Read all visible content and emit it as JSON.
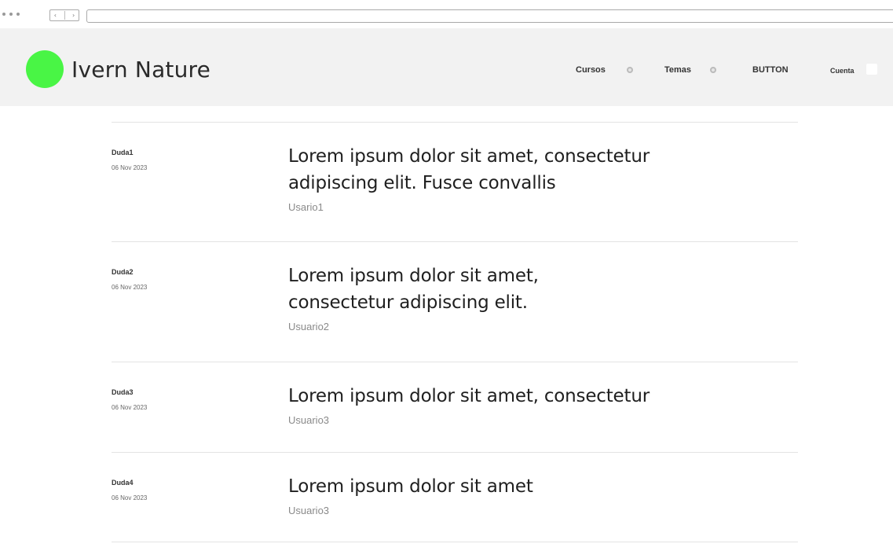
{
  "header": {
    "brand_name": "Ivern Nature",
    "logo_color": "#49f545",
    "nav": {
      "cursos": "Cursos",
      "temas": "Temas",
      "button": "BUTTON",
      "cuenta": "Cuenta"
    }
  },
  "threads": [
    {
      "tag": "Duda1",
      "date": "06 Nov 2023",
      "title": "Lorem ipsum dolor sit amet, consectetur adipiscing elit. Fusce convallis",
      "user": "Usario1"
    },
    {
      "tag": "Duda2",
      "date": "06 Nov 2023",
      "title": "Lorem ipsum dolor sit amet, consectetur adipiscing elit.",
      "user": "Usuario2"
    },
    {
      "tag": "Duda3",
      "date": "06 Nov 2023",
      "title": "Lorem ipsum dolor sit amet, consectetur",
      "user": "Usuario3"
    },
    {
      "tag": "Duda4",
      "date": "06 Nov 2023",
      "title": "Lorem ipsum dolor sit amet",
      "user": "Usuario3"
    }
  ]
}
